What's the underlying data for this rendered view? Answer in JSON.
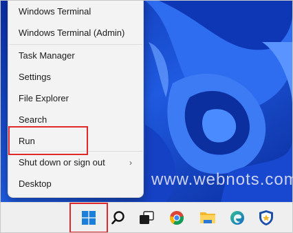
{
  "menu": {
    "items": [
      {
        "label": "Windows Terminal"
      },
      {
        "label": "Windows Terminal (Admin)"
      },
      {
        "label": "Task Manager"
      },
      {
        "label": "Settings"
      },
      {
        "label": "File Explorer"
      },
      {
        "label": "Search"
      },
      {
        "label": "Run"
      },
      {
        "label": "Shut down or sign out"
      },
      {
        "label": "Desktop"
      }
    ]
  },
  "watermark": "www.webnots.com",
  "taskbar": {
    "icons": [
      "windows-start-icon",
      "search-icon",
      "task-view-icon",
      "chrome-icon",
      "file-explorer-icon",
      "edge-icon",
      "security-shield-icon"
    ]
  },
  "colors": {
    "highlight": "#e1262c",
    "wallpaper": "#1f56d8"
  }
}
